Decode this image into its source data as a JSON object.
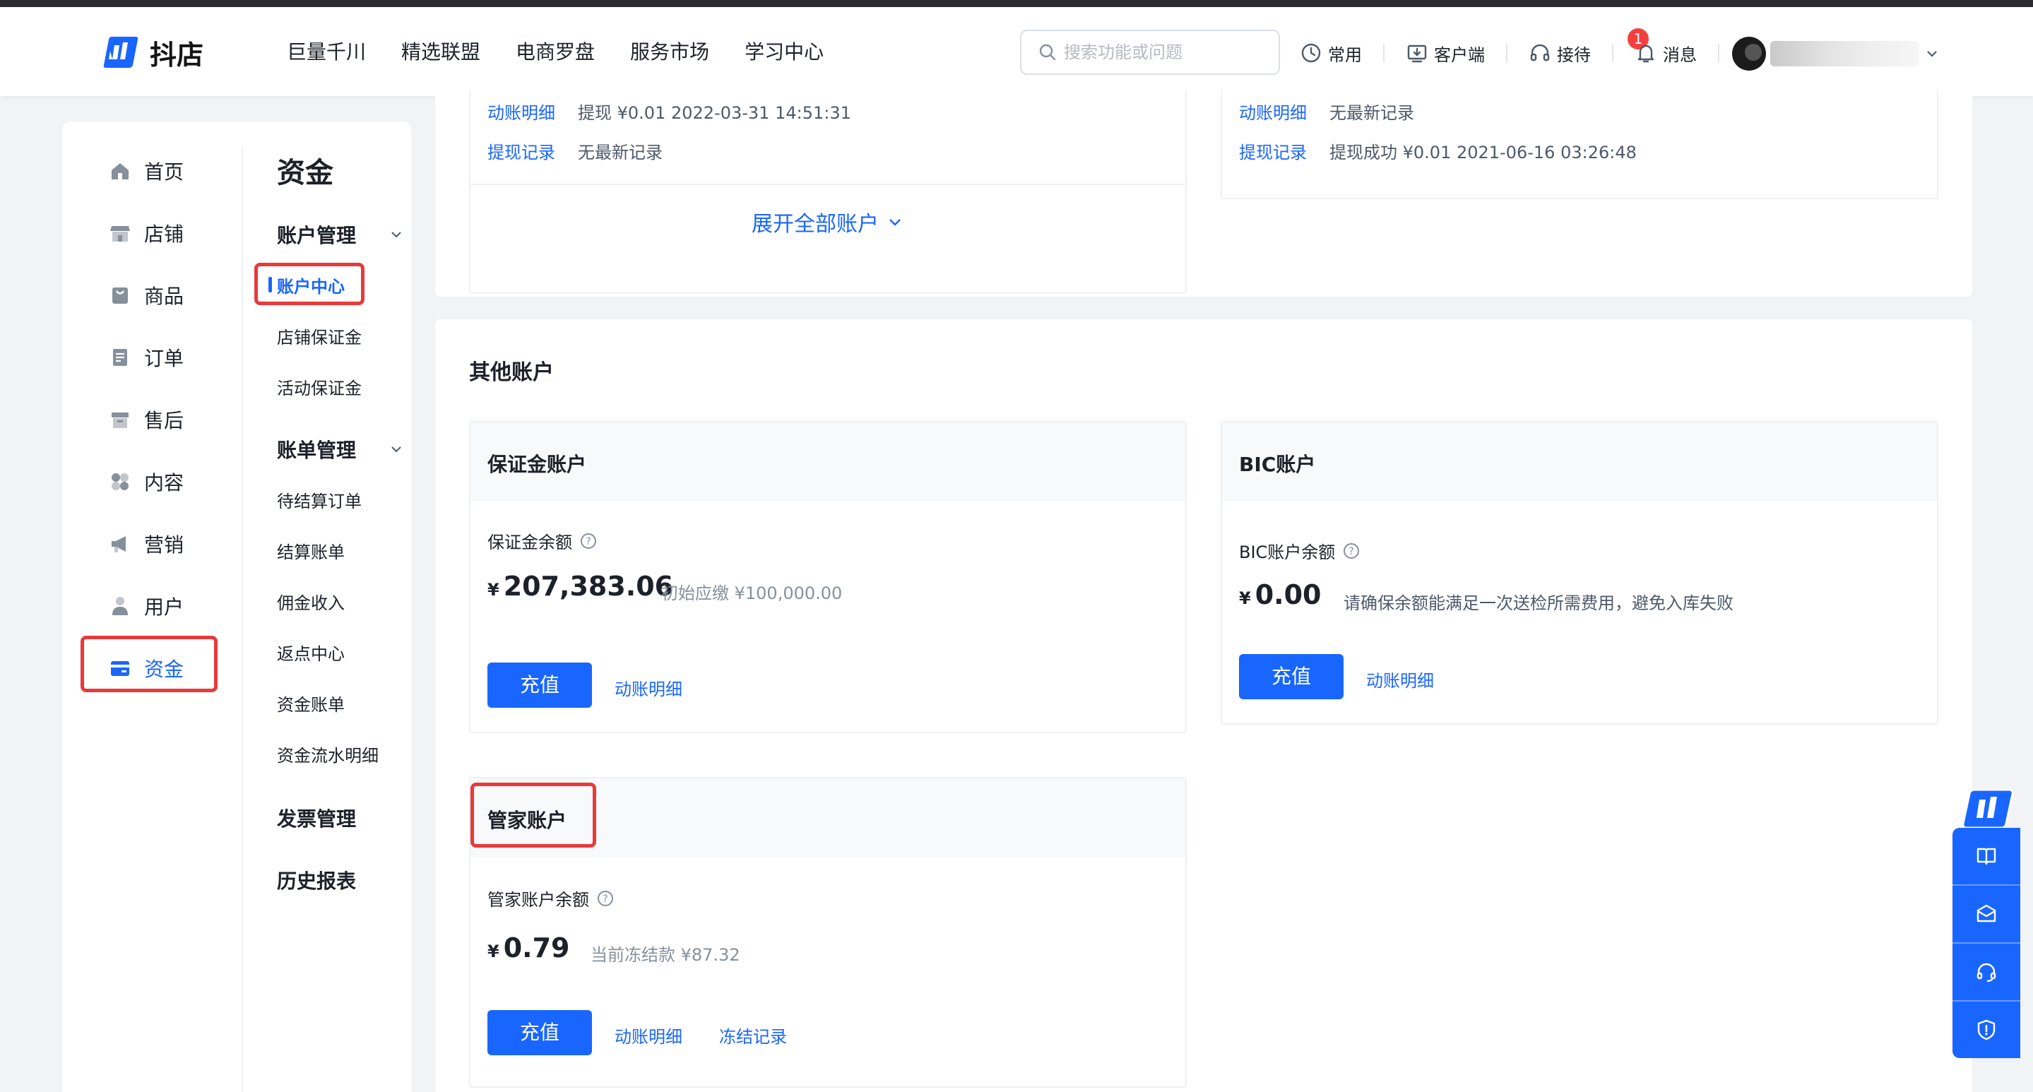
{
  "header": {
    "brand": "抖店",
    "nav": [
      "巨量千川",
      "精选联盟",
      "电商罗盘",
      "服务市场",
      "学习中心"
    ],
    "search_placeholder": "搜索功能或问题",
    "tools": {
      "common": "常用",
      "client": "客户端",
      "reception": "接待",
      "reception_badge": "1",
      "messages": "消息"
    },
    "icons": [
      "clock-icon",
      "download-icon",
      "headset-icon",
      "bell-icon"
    ]
  },
  "sidebar": {
    "main_nav": [
      "首页",
      "店铺",
      "商品",
      "订单",
      "售后",
      "内容",
      "营销",
      "用户",
      "资金"
    ],
    "active": "资金",
    "section_title": "资金",
    "groups": {
      "account": "账户管理",
      "bill": "账单管理",
      "invoice": "发票管理",
      "history": "历史报表"
    },
    "account_items": [
      "账户中心",
      "店铺保证金",
      "活动保证金"
    ],
    "bill_items": [
      "待结算订单",
      "结算账单",
      "佣金收入",
      "返点中心",
      "资金账单",
      "资金流水明细"
    ]
  },
  "top_cards": {
    "left": {
      "detail_link": "动账明细",
      "detail_text": "提现  ¥0.01  2022-03-31 14:51:31",
      "withdraw_link": "提现记录",
      "withdraw_text": "无最新记录",
      "expand": "展开全部账户"
    },
    "right": {
      "detail_link": "动账明细",
      "detail_text": "无最新记录",
      "withdraw_link": "提现记录",
      "withdraw_text": "提现成功  ¥0.01  2021-06-16 03:26:48"
    }
  },
  "other_accounts": {
    "title": "其他账户",
    "deposit": {
      "title": "保证金账户",
      "label": "保证金余额",
      "currency": "¥",
      "amount": "207,383.06",
      "note": "初始应缴 ¥100,000.00",
      "recharge": "充值",
      "detail": "动账明细"
    },
    "bic": {
      "title": "BIC账户",
      "label": "BIC账户余额",
      "currency": "¥",
      "amount": "0.00",
      "note": "请确保余额能满足一次送检所需费用，避免入库失败",
      "recharge": "充值",
      "detail": "动账明细"
    },
    "steward": {
      "title": "管家账户",
      "label": "管家账户余额",
      "currency": "¥",
      "amount": "0.79",
      "note": "当前冻结款 ¥87.32",
      "recharge": "充值",
      "detail": "动账明细",
      "freeze": "冻结记录"
    }
  },
  "colors": {
    "primary": "#1966ff",
    "highlight": "#e83a3a",
    "badge": "#f53f3f"
  }
}
